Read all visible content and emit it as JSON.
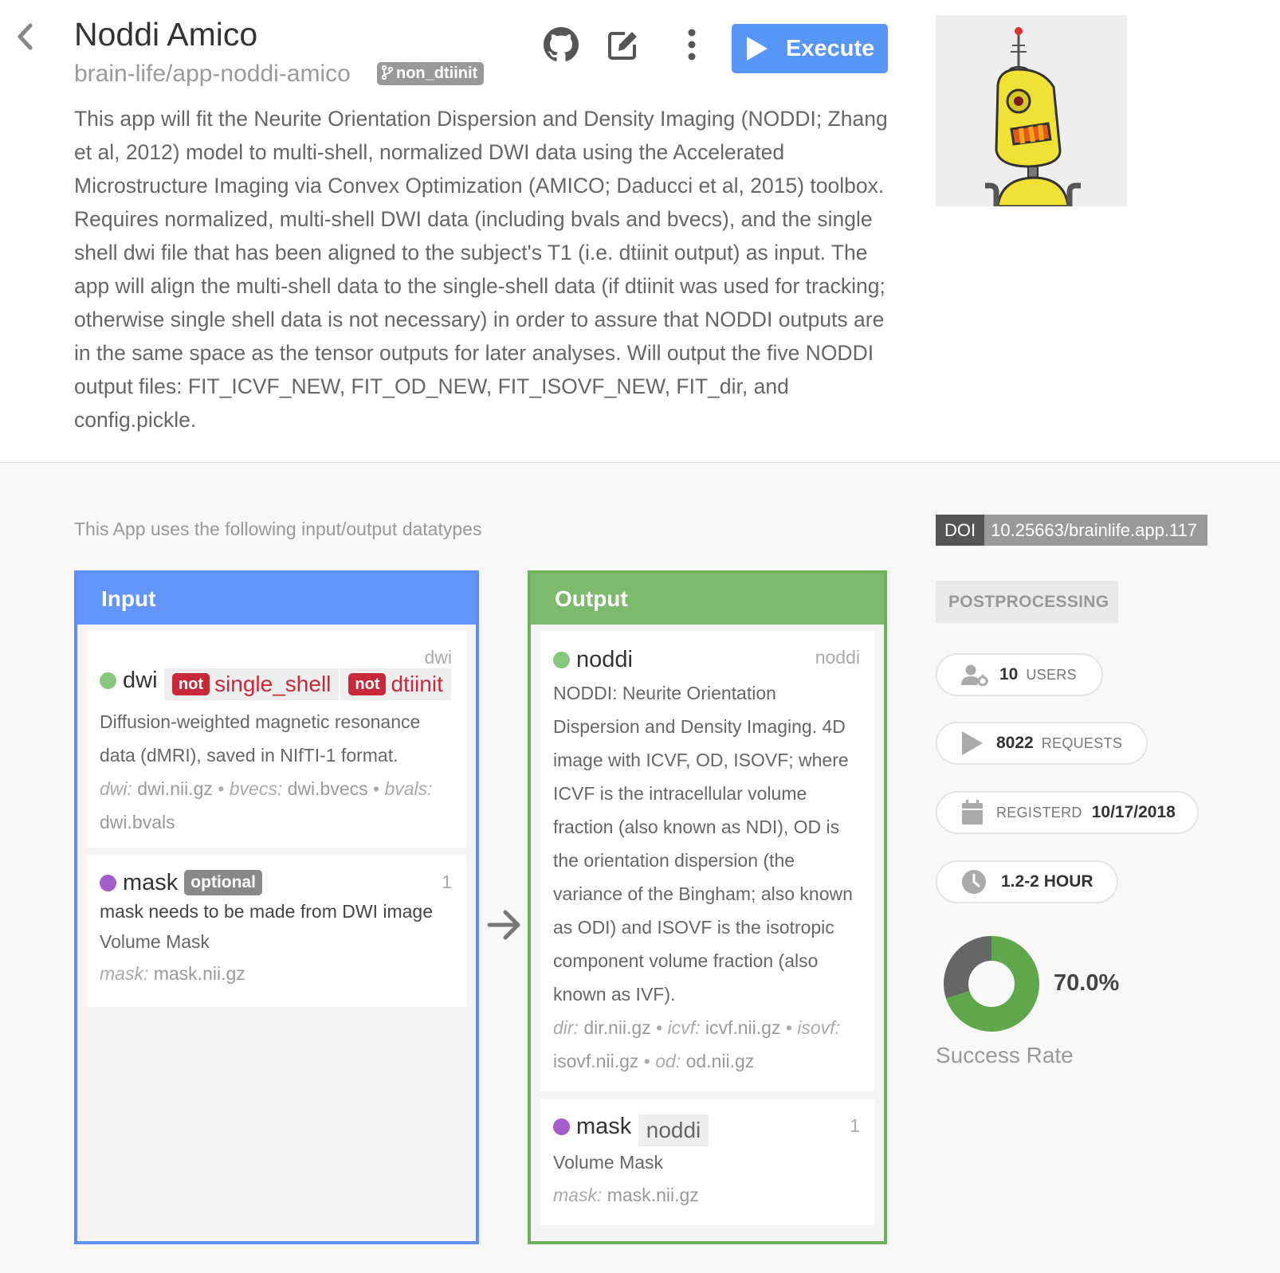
{
  "header": {
    "title": "Noddi Amico",
    "repo": "brain-life/app-noddi-amico",
    "branch": "non_dtiinit",
    "description": "This app will fit the Neurite Orientation Dispersion and Density Imaging (NODDI; Zhang et al, 2012) model to multi-shell, normalized DWI data using the Accelerated Microstructure Imaging via Convex Optimization (AMICO; Daducci et al, 2015) toolbox. Requires normalized, multi-shell DWI data (including bvals and bvecs), and the single shell dwi file that has been aligned to the subject's T1 (i.e. dtiinit output) as input. The app will align the multi-shell data to the single-shell data (if dtiinit was used for tracking; otherwise single shell data is not necessary) in order to assure that NODDI outputs are in the same space as the tensor outputs for later analyses. Will output the five NODDI output files: FIT_ICVF_NEW, FIT_OD_NEW, FIT_ISOVF_NEW, FIT_dir, and config.pickle.",
    "execute_label": "Execute",
    "icons": [
      "back-icon",
      "github-icon",
      "edit-icon",
      "more-vert-icon",
      "play-icon"
    ]
  },
  "io": {
    "intro": "This App uses the following input/output datatypes",
    "input_title": "Input",
    "output_title": "Output",
    "inputs": [
      {
        "id_tag": "dwi",
        "name": "dwi",
        "not_label": "not",
        "tags": [
          "single_shell",
          "dtiinit"
        ],
        "desc": "Diffusion-weighted magnetic resonance data (dMRI), saved in NIfTI-1 format.",
        "files": [
          {
            "k": "dwi:",
            "v": "dwi.nii.gz"
          },
          {
            "k": "bvecs:",
            "v": "dwi.bvecs"
          },
          {
            "k": "bvals:",
            "v": "dwi.bvals"
          }
        ]
      },
      {
        "id_tag": "1",
        "name": "mask",
        "optional_label": "optional",
        "note": "mask needs to be made from DWI image",
        "desc": "Volume Mask",
        "files": [
          {
            "k": "mask:",
            "v": "mask.nii.gz"
          }
        ]
      }
    ],
    "outputs": [
      {
        "id_tag": "noddi",
        "name": "noddi",
        "desc": "NODDI: Neurite Orientation Dispersion and Density Imaging. 4D image with ICVF, OD, ISOVF; where ICVF is the intracellular volume fraction (also known as NDI), OD is the orientation dispersion (the variance of the Bingham; also known as ODI) and ISOVF is the isotropic component volume fraction (also known as IVF).",
        "files": [
          {
            "k": "dir:",
            "v": "dir.nii.gz"
          },
          {
            "k": "icvf:",
            "v": "icvf.nii.gz"
          },
          {
            "k": "isovf:",
            "v": "isovf.nii.gz"
          },
          {
            "k": "od:",
            "v": "od.nii.gz"
          }
        ]
      },
      {
        "id_tag": "1",
        "name": "mask",
        "tag": "noddi",
        "desc": "Volume Mask",
        "files": [
          {
            "k": "mask:",
            "v": "mask.nii.gz"
          }
        ]
      }
    ]
  },
  "sidebar": {
    "doi_key": "DOI",
    "doi_value": "10.25663/brainlife.app.117",
    "category": "POSTPROCESSING",
    "users_count": "10",
    "users_label": "USERS",
    "requests_count": "8022",
    "requests_label": "REQUESTS",
    "registered_label": "REGISTERD",
    "registered_date": "10/17/2018",
    "runtime": "1.2-2 HOUR",
    "success_rate_text": "70.0%",
    "success_rate": 0.7,
    "success_label": "Success Rate",
    "colors": {
      "success": "#5ea84b",
      "failure": "#666666"
    }
  }
}
